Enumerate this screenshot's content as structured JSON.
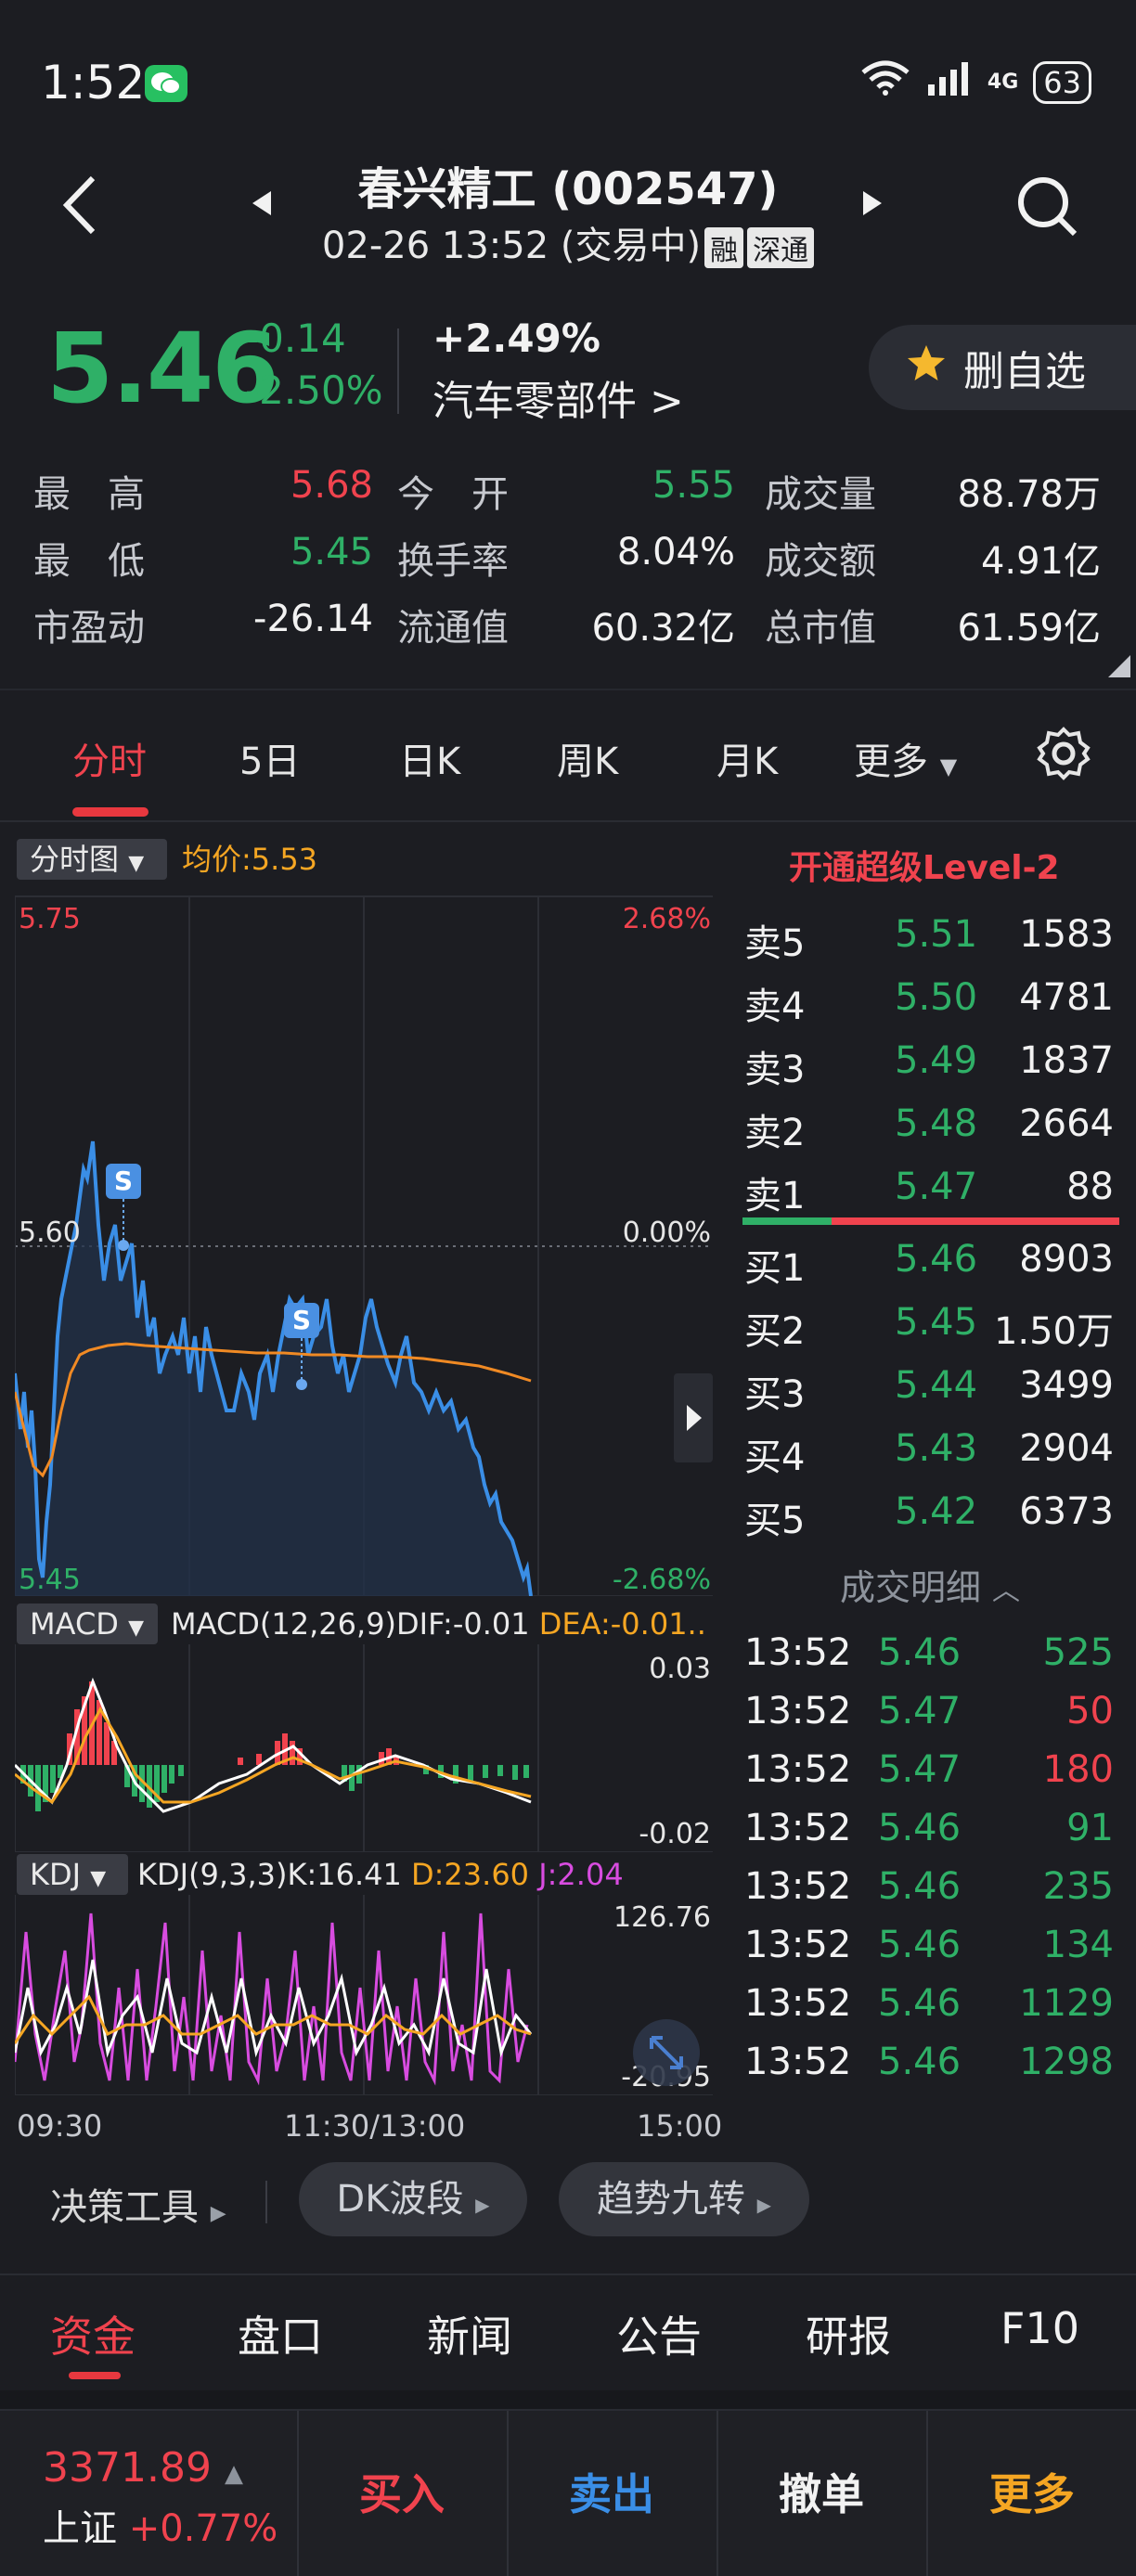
{
  "status": {
    "time": "1:52",
    "signal": "4G",
    "battery": "63"
  },
  "header": {
    "title": "春兴精工 (002547)",
    "subtitle": "02-26 13:52 (交易中)",
    "tag1": "融",
    "tag2": "深通"
  },
  "quote": {
    "price": "5.46",
    "change": "-0.14",
    "change_pct": "-2.50%",
    "sector_pct": "+2.49%",
    "sector": "汽车零部件 >",
    "fav_label": "删自选"
  },
  "stats": [
    {
      "label": "最　高",
      "value": "5.68",
      "color": "red"
    },
    {
      "label": "今　开",
      "value": "5.55",
      "color": "green"
    },
    {
      "label": "成交量",
      "value": "88.78万",
      "color": "white"
    },
    {
      "label": "最　低",
      "value": "5.45",
      "color": "green"
    },
    {
      "label": "换手率",
      "value": "8.04%",
      "color": "white"
    },
    {
      "label": "成交额",
      "value": "4.91亿",
      "color": "white"
    },
    {
      "label": "市盈动",
      "value": "-26.14",
      "color": "white"
    },
    {
      "label": "流通值",
      "value": "60.32亿",
      "color": "white"
    },
    {
      "label": "总市值",
      "value": "61.59亿",
      "color": "white"
    }
  ],
  "tabs": [
    "分时",
    "5日",
    "日K",
    "周K",
    "月K",
    "更多"
  ],
  "chart": {
    "selector": "分时图",
    "avg_label": "均价:5.53",
    "level2": "开通超级Level-2",
    "y_top": "5.75",
    "y_mid": "5.60",
    "y_bot": "5.45",
    "pct_top": "2.68%",
    "pct_mid": "0.00%",
    "pct_bot": "-2.68%",
    "macd_selector": "MACD",
    "macd_params": "MACD(12,26,9)",
    "macd_dif": "DIF:-0.01",
    "macd_dea": "DEA:-0.01...",
    "macd_top": "0.03",
    "macd_bot": "-0.02",
    "kdj_selector": "KDJ",
    "kdj_params": "KDJ(9,3,3)",
    "kdj_k": "K:16.41",
    "kdj_d": "D:23.60",
    "kdj_j": "J:2.04",
    "kdj_top": "126.76",
    "kdj_bot": "-20.95",
    "time_start": "09:30",
    "time_mid": "11:30/13:00",
    "time_end": "15:00",
    "marker": "S"
  },
  "order_book": [
    {
      "side": "卖5",
      "price": "5.51",
      "vol": "1583"
    },
    {
      "side": "卖4",
      "price": "5.50",
      "vol": "4781"
    },
    {
      "side": "卖3",
      "price": "5.49",
      "vol": "1837"
    },
    {
      "side": "卖2",
      "price": "5.48",
      "vol": "2664"
    },
    {
      "side": "卖1",
      "price": "5.47",
      "vol": "88"
    },
    {
      "side": "买1",
      "price": "5.46",
      "vol": "8903"
    },
    {
      "side": "买2",
      "price": "5.45",
      "vol": "1.50万"
    },
    {
      "side": "买3",
      "price": "5.44",
      "vol": "3499"
    },
    {
      "side": "买4",
      "price": "5.43",
      "vol": "2904"
    },
    {
      "side": "买5",
      "price": "5.42",
      "vol": "6373"
    }
  ],
  "trades_header": "成交明细",
  "trades": [
    {
      "time": "13:52",
      "price": "5.46",
      "vol": "525",
      "dir": "green"
    },
    {
      "time": "13:52",
      "price": "5.47",
      "vol": "50",
      "dir": "red"
    },
    {
      "time": "13:52",
      "price": "5.47",
      "vol": "180",
      "dir": "red"
    },
    {
      "time": "13:52",
      "price": "5.46",
      "vol": "91",
      "dir": "green"
    },
    {
      "time": "13:52",
      "price": "5.46",
      "vol": "235",
      "dir": "green"
    },
    {
      "time": "13:52",
      "price": "5.46",
      "vol": "134",
      "dir": "green"
    },
    {
      "time": "13:52",
      "price": "5.46",
      "vol": "1129",
      "dir": "green"
    },
    {
      "time": "13:52",
      "price": "5.46",
      "vol": "1298",
      "dir": "green"
    }
  ],
  "tools": {
    "label": "决策工具",
    "pill1": "DK波段",
    "pill2": "趋势九转"
  },
  "bottom_tabs": [
    "资金",
    "盘口",
    "新闻",
    "公告",
    "研报",
    "F10"
  ],
  "trade_bar": {
    "index_value": "3371.89",
    "index_name": "上证",
    "index_change": "+0.77%",
    "buy": "买入",
    "sell": "卖出",
    "cancel": "撤单",
    "more": "更多"
  },
  "colors": {
    "up": "#f0434e",
    "down": "#2fb067",
    "price_line": "#3a8ee6",
    "avg_line": "#f08a24",
    "background": "#1c1d22"
  }
}
